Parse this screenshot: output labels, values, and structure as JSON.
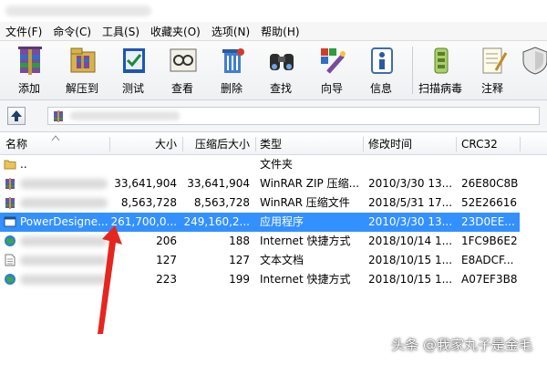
{
  "menu": [
    "文件(F)",
    "命令(C)",
    "工具(S)",
    "收藏夹(O)",
    "选项(N)",
    "帮助(H)"
  ],
  "toolbar": [
    {
      "label": "添加",
      "icon": "add-archive-icon"
    },
    {
      "label": "解压到",
      "icon": "extract-to-icon"
    },
    {
      "label": "测试",
      "icon": "test-icon"
    },
    {
      "label": "查看",
      "icon": "view-icon"
    },
    {
      "label": "删除",
      "icon": "delete-icon"
    },
    {
      "label": "查找",
      "icon": "find-icon"
    },
    {
      "label": "向导",
      "icon": "wizard-icon"
    },
    {
      "label": "信息",
      "icon": "info-icon"
    },
    {
      "label": "扫描病毒",
      "icon": "scan-virus-icon"
    },
    {
      "label": "注释",
      "icon": "comment-icon"
    }
  ],
  "columns": {
    "name": "名称",
    "size": "大小",
    "packed": "压缩后大小",
    "type": "类型",
    "modified": "修改时间",
    "crc": "CRC32"
  },
  "rows": [
    {
      "name": "..",
      "size": "",
      "packed": "",
      "type": "文件夹",
      "modified": "",
      "crc": "",
      "icon": "folder-icon"
    },
    {
      "name": "",
      "size": "33,641,904",
      "packed": "33,641,904",
      "type": "WinRAR ZIP 压缩...",
      "modified": "2010/3/30 13...",
      "crc": "26E80C8B",
      "icon": "rar-archive-icon"
    },
    {
      "name": "",
      "size": "8,563,728",
      "packed": "8,563,728",
      "type": "WinRAR 压缩文件",
      "modified": "2018/5/31 17...",
      "crc": "52E26616",
      "icon": "rar-archive-icon"
    },
    {
      "name": "PowerDesigne...",
      "size": "261,700,0...",
      "packed": "249,160,2...",
      "type": "应用程序",
      "modified": "2010/3/30 13...",
      "crc": "23D0EE...",
      "icon": "application-icon",
      "selected": true
    },
    {
      "name": "",
      "size": "206",
      "packed": "188",
      "type": "Internet 快捷方式",
      "modified": "2018/10/14 1...",
      "crc": "1FC9B6E2",
      "icon": "internet-shortcut-icon"
    },
    {
      "name": "",
      "size": "127",
      "packed": "127",
      "type": "文本文档",
      "modified": "2018/10/15 1...",
      "crc": "E8ADCF...",
      "icon": "text-document-icon"
    },
    {
      "name": "",
      "size": "223",
      "packed": "199",
      "type": "Internet 快捷方式",
      "modified": "2018/10/15 1...",
      "crc": "A07EF3B8",
      "icon": "internet-shortcut-icon"
    }
  ],
  "watermark": "头条 @我家丸子是金毛",
  "colors": {
    "selection": "#3390ff",
    "arrow": "#e5261f"
  }
}
